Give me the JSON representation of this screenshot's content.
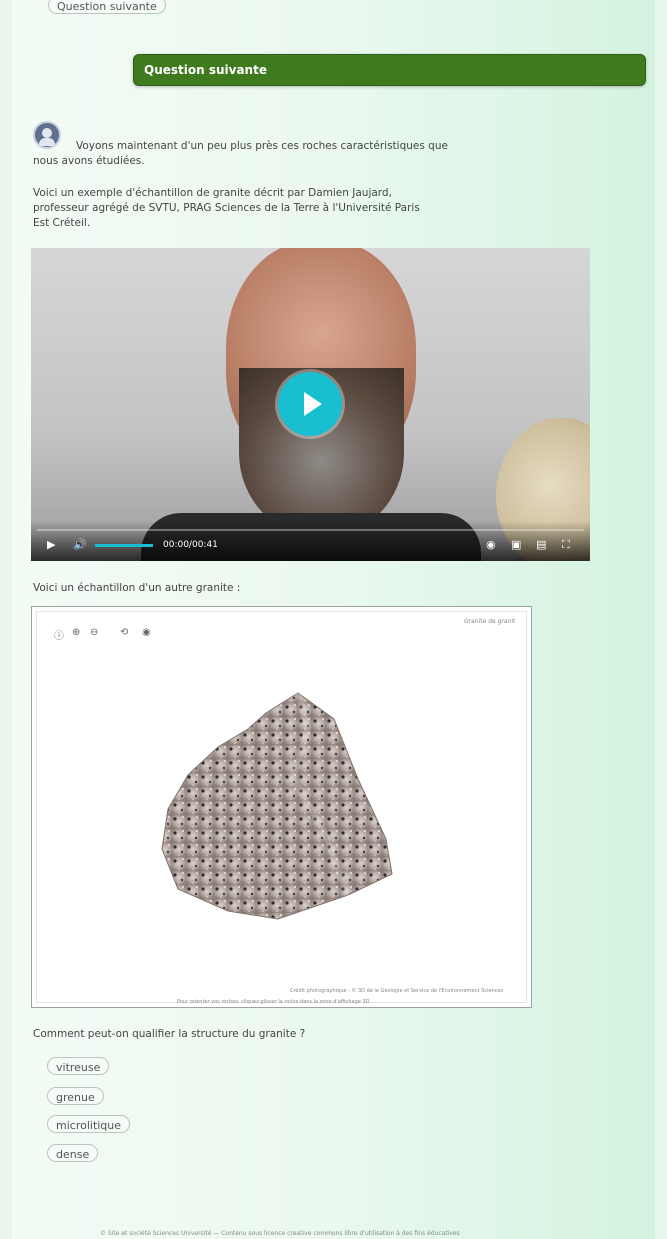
{
  "top_pill": {
    "label": "Question suivante"
  },
  "next_button": {
    "label": "Question suivante",
    "color": "#3f7a1f"
  },
  "intro": {
    "line1": "Voyons maintenant d'un peu plus près ces roches caractéristiques que",
    "line2": "nous avons étudiées.",
    "para_l1": "Voici un exemple d'échantillon de granite décrit par Damien Jaujard,",
    "para_l2": "professeur agrégé de SVTU, PRAG Sciences de la Terre à l'Université Paris",
    "para_l3": "Est Créteil."
  },
  "video": {
    "time": "00:00/00:41",
    "accent": "#17bfd0",
    "progress": 0.0
  },
  "second_sample": {
    "label": "Voici un échantillon d'un autre granite :"
  },
  "viewer": {
    "title": "Granite de granit",
    "credit_line": "Crédit photographique : © 3D de la Géologie et Service de l'Environnement Sciences",
    "caption": "Pour orienter vos roches, cliquez-glisser la roche dans la zone d'affichage 3D"
  },
  "question": {
    "text": "Comment peut-on qualifier la structure du granite ?",
    "options": [
      "vitreuse",
      "grenue",
      "microlitique",
      "dense"
    ]
  },
  "footer": {
    "text": "© Site et société Sciences Université — Contenu sous licence creative commons libre d'utilisation à des fins éducatives"
  },
  "icons": [
    "user-icon",
    "play-icon",
    "volume-icon",
    "camera-icon",
    "pip-icon",
    "settings-icon",
    "fullscreen-icon",
    "zoom-in-icon",
    "zoom-out-icon",
    "info-icon"
  ]
}
